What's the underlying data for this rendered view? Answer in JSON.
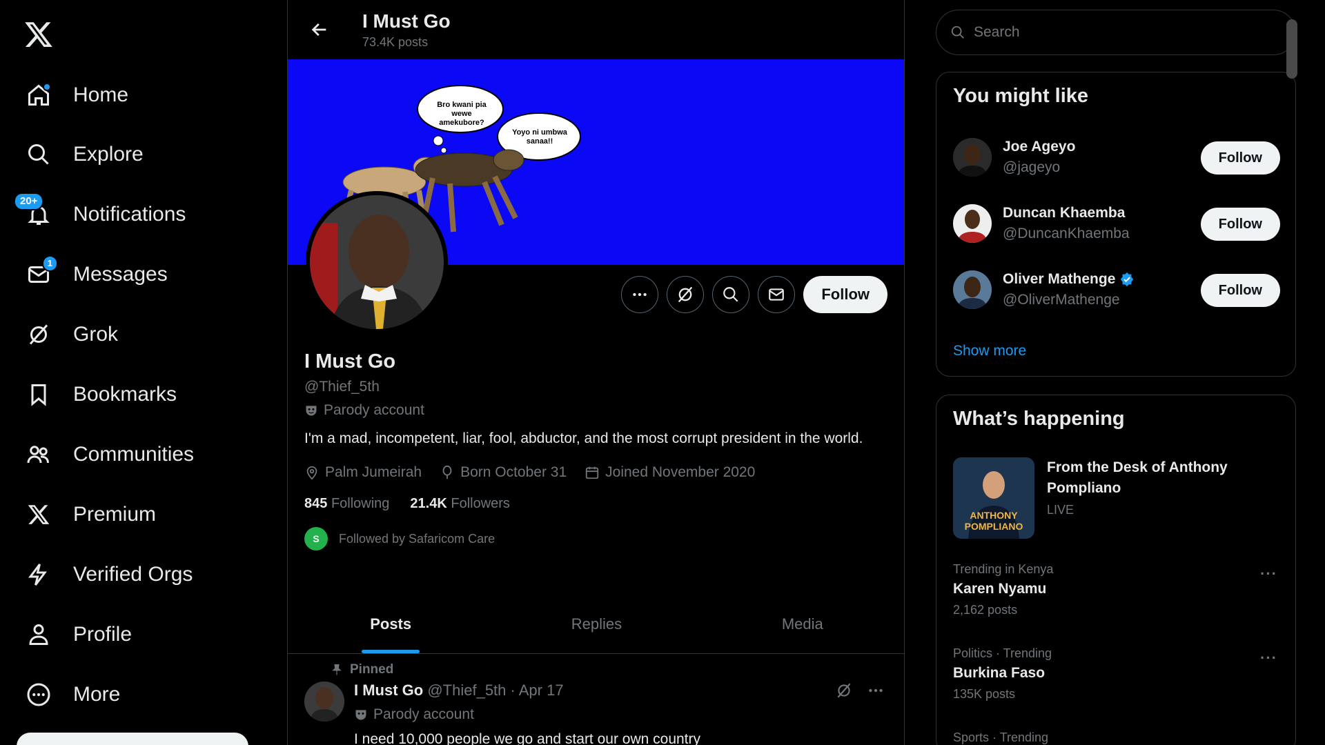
{
  "nav": {
    "items": [
      {
        "label": "Home",
        "icon": "home-icon"
      },
      {
        "label": "Explore",
        "icon": "search-icon"
      },
      {
        "label": "Notifications",
        "icon": "bell-icon",
        "badge": "20+"
      },
      {
        "label": "Messages",
        "icon": "envelope-icon",
        "badge": "1"
      },
      {
        "label": "Grok",
        "icon": "grok-icon"
      },
      {
        "label": "Bookmarks",
        "icon": "bookmark-icon"
      },
      {
        "label": "Communities",
        "icon": "people-icon"
      },
      {
        "label": "Premium",
        "icon": "x-logo-icon"
      },
      {
        "label": "Verified Orgs",
        "icon": "lightning-icon"
      },
      {
        "label": "Profile",
        "icon": "person-icon"
      },
      {
        "label": "More",
        "icon": "more-circle-icon"
      }
    ]
  },
  "header": {
    "name": "I Must Go",
    "posts": "73.4K posts"
  },
  "banner": {
    "bubble1": "Bro kwani pia wewe amekubore?",
    "bubble2": "Yoyo ni umbwa sanaa!!"
  },
  "profile": {
    "follow_label": "Follow",
    "name": "I Must Go",
    "handle": "@Thief_5th",
    "parody": "Parody account",
    "bio": "I'm a mad, incompetent, liar, fool, abductor, and the most corrupt president in the world.",
    "location": "Palm Jumeirah",
    "born": "Born October 31",
    "joined": "Joined November 2020",
    "following_count": "845",
    "following_label": "Following",
    "followers_count": "21.4K",
    "followers_label": "Followers",
    "followed_by": "Followed by Safaricom Care"
  },
  "tabs": [
    "Posts",
    "Replies",
    "Media"
  ],
  "tweet": {
    "pinned": "Pinned",
    "name": "I Must Go",
    "meta": "@Thief_5th · Apr 17",
    "parody": "Parody account",
    "text": "I need 10,000 people we go and start our own country"
  },
  "search": {
    "placeholder": "Search"
  },
  "suggestions": {
    "title": "You might like",
    "items": [
      {
        "name": "Joe Ageyo",
        "handle": "@jageyo",
        "follow": "Follow"
      },
      {
        "name": "Duncan Khaemba",
        "handle": "@DuncanKhaemba",
        "follow": "Follow"
      },
      {
        "name": "Oliver Mathenge",
        "handle": "@OliverMathenge",
        "follow": "Follow",
        "verified": true
      }
    ],
    "show_more": "Show more"
  },
  "happening": {
    "title": "What’s happening",
    "live": {
      "title": "From the Desk of Anthony Pompliano",
      "status": "LIVE",
      "thumb_text": "ANTHONY POMPLIANO"
    },
    "trends": [
      {
        "meta": "Trending in Kenya",
        "title": "Karen Nyamu",
        "count": "2,162 posts"
      },
      {
        "meta": "Politics · Trending",
        "title": "Burkina Faso",
        "count": "135K posts"
      },
      {
        "meta": "Sports · Trending",
        "title": "",
        "count": ""
      }
    ]
  },
  "colors": {
    "accent": "#1d9bf0",
    "banner": "#0a08f5",
    "background": "#000000"
  }
}
